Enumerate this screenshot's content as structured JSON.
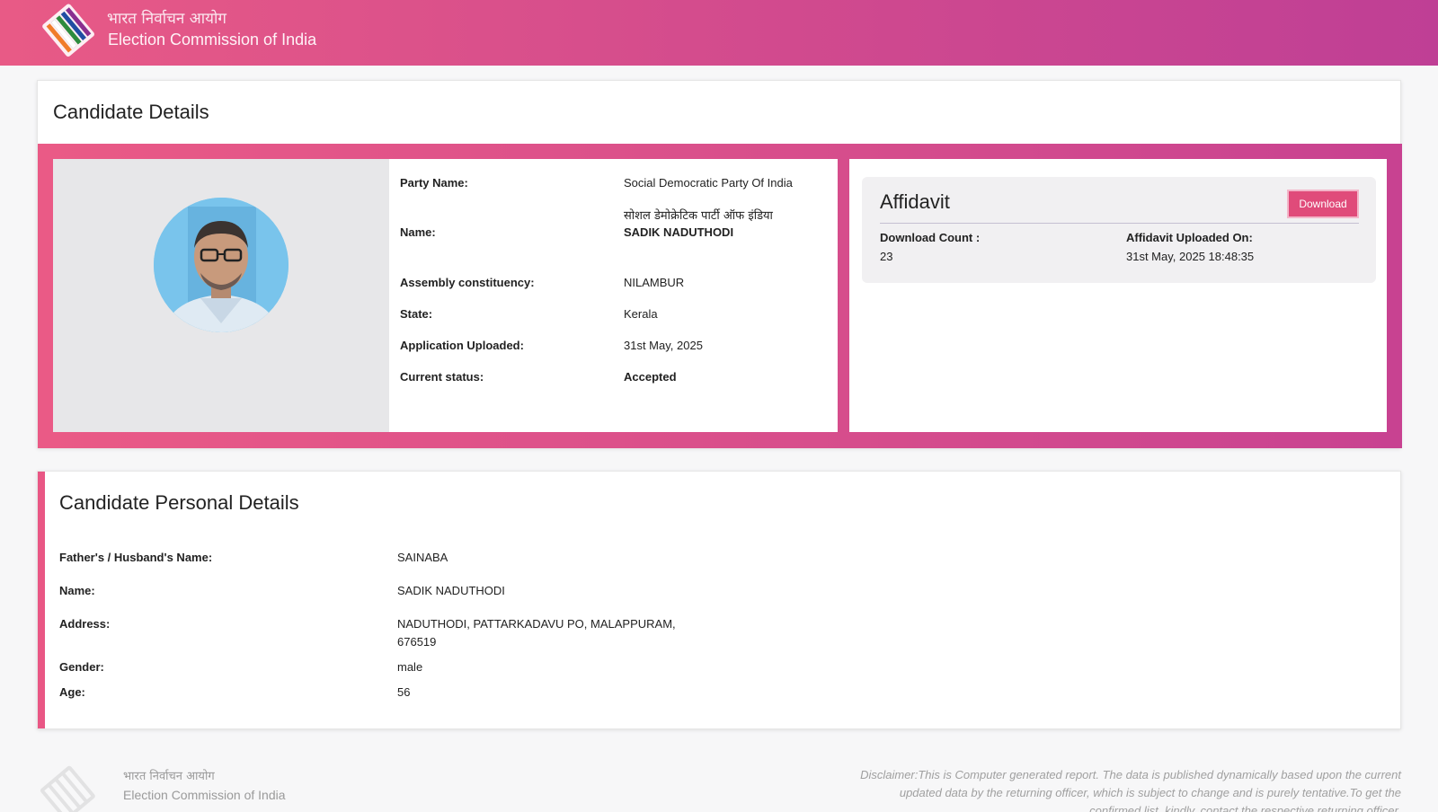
{
  "header": {
    "hindi_title": "भारत निर्वाचन आयोग",
    "english_title": "Election Commission of India"
  },
  "candidate_details": {
    "title": "Candidate Details",
    "fields": [
      {
        "label": "Party Name:",
        "value": "Social Democratic Party Of India"
      },
      {
        "label": "Name:",
        "value_hindi": "सोशल डेमोक्रेटिक पार्टी ऑफ इंडिया",
        "value": "SADIK NADUTHODI"
      },
      {
        "label": "Assembly constituency:",
        "value": "NILAMBUR"
      },
      {
        "label": "State:",
        "value": "Kerala"
      },
      {
        "label": "Application Uploaded:",
        "value": "31st May, 2025"
      },
      {
        "label": "Current status:",
        "value": "Accepted"
      }
    ],
    "status_color": "#1e9a4a"
  },
  "affidavit": {
    "title": "Affidavit",
    "download_label": "Download",
    "download_count_label": "Download Count :",
    "download_count": "23",
    "uploaded_on_label": "Affidavit Uploaded On:",
    "uploaded_on": "31st May, 2025 18:48:35"
  },
  "personal_details": {
    "title": "Candidate Personal Details",
    "fields": [
      {
        "label": "Father's / Husband's Name:",
        "value": "SAINABA"
      },
      {
        "label": "Name:",
        "value": "SADIK NADUTHODI"
      },
      {
        "label": "Address:",
        "value_line1": "NADUTHODI, PATTARKADAVU PO, MALAPPURAM,",
        "value_line2": "676519"
      },
      {
        "label": "Gender:",
        "value": "male"
      },
      {
        "label": "Age:",
        "value": "56"
      }
    ]
  },
  "footer": {
    "hindi_title": "भारत निर्वाचन आयोग",
    "english_title": "Election Commission of India",
    "disclaimer_line1": "Disclaimer:This is Computer generated report. The data is published dynamically based upon the current",
    "disclaimer_line2": "updated data by the returning officer, which is subject to change and is purely tentative.To get the",
    "disclaimer_line3": "confirmed list, kindly, contact the respective returning officer."
  },
  "colors": {
    "brand_pink": "#e85a86",
    "brand_magenta": "#bf3f95",
    "button": "#e04b7a",
    "accepted": "#1e9a4a"
  }
}
